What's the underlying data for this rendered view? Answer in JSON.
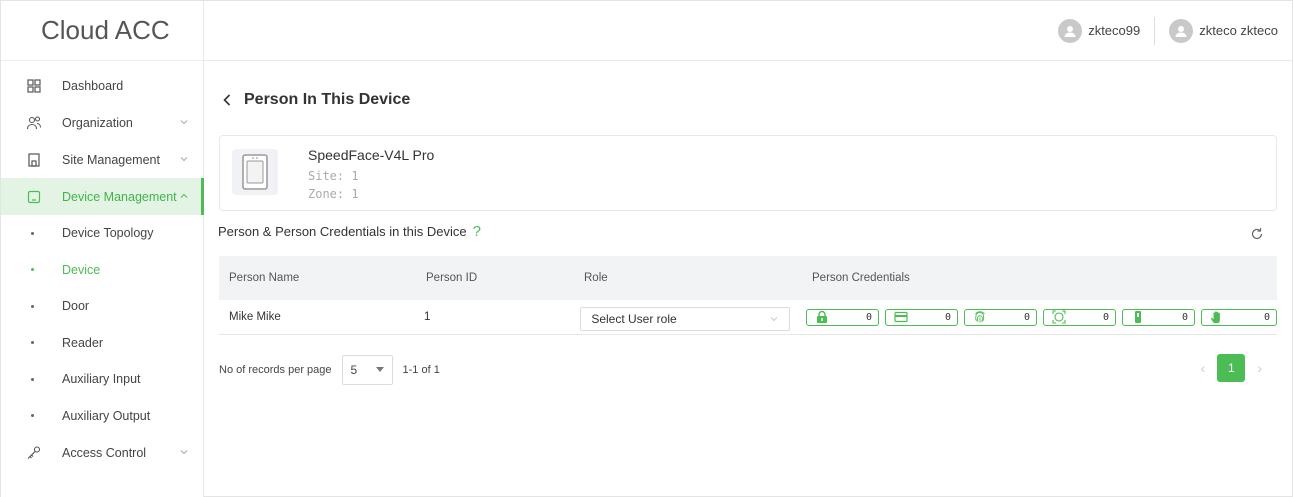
{
  "app": {
    "title": "Cloud ACC"
  },
  "header": {
    "users": [
      {
        "name": "zkteco99"
      },
      {
        "name": "zkteco zkteco"
      }
    ]
  },
  "sidebar": {
    "items": [
      {
        "label": "Dashboard",
        "icon": "grid-icon"
      },
      {
        "label": "Organization",
        "icon": "people-icon"
      },
      {
        "label": "Site Management",
        "icon": "building-icon"
      },
      {
        "label": "Device Management",
        "icon": "device-icon"
      }
    ],
    "device_sub": [
      {
        "label": "Device Topology"
      },
      {
        "label": "Device"
      },
      {
        "label": "Door"
      },
      {
        "label": "Reader"
      },
      {
        "label": "Auxiliary Input"
      },
      {
        "label": "Auxiliary Output"
      }
    ],
    "access_control": {
      "label": "Access Control",
      "icon": "key-icon"
    }
  },
  "page": {
    "title": "Person In This Device"
  },
  "device": {
    "name": "SpeedFace-V4L Pro",
    "site": "Site: 1",
    "zone": "Zone: 1"
  },
  "section": {
    "title": "Person & Person Credentials in this Device",
    "help": "?"
  },
  "table": {
    "headers": [
      "Person Name",
      "Person ID",
      "Role",
      "Person Credentials"
    ],
    "rows": [
      {
        "name": "Mike Mike",
        "id": "1",
        "role_placeholder": "Select User role",
        "credentials": [
          {
            "type": "password-icon",
            "count": "0"
          },
          {
            "type": "card-icon",
            "count": "0"
          },
          {
            "type": "fingerprint-icon",
            "count": "0"
          },
          {
            "type": "face-icon",
            "count": "0"
          },
          {
            "type": "palm-vein-icon",
            "count": "0"
          },
          {
            "type": "palm-icon",
            "count": "0"
          }
        ]
      }
    ]
  },
  "pagination": {
    "label": "No of records per page",
    "per_page": "5",
    "range": "1-1 of 1",
    "current_page": "1"
  },
  "colors": {
    "accent": "#4cbc55",
    "active_bg": "#e4f4e4"
  }
}
